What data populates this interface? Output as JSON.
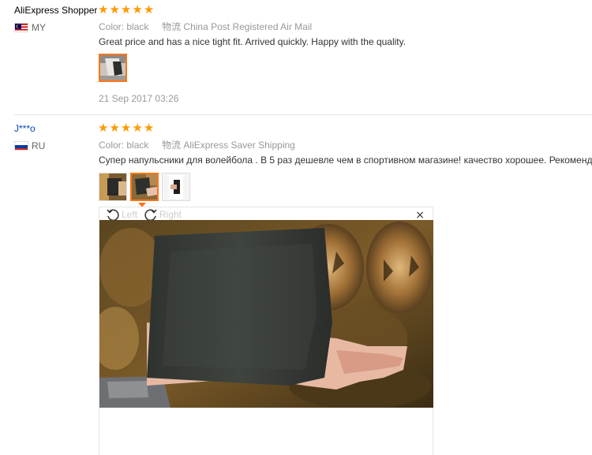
{
  "reviews": [
    {
      "user": "AliExpress Shopper",
      "country": "MY",
      "rating": 5,
      "color_label": "Color:",
      "color_value": "black",
      "shipping_label": "物流",
      "shipping_value": "China Post Registered Air Mail",
      "text": "Great price and has a nice tight fit. Arrived quickly. Happy with the quality.",
      "date": "21 Sep 2017 03:26"
    },
    {
      "user": "J***o",
      "country": "RU",
      "rating": 5,
      "color_label": "Color:",
      "color_value": "black",
      "shipping_label": "物流",
      "shipping_value": "AliExpress Saver Shipping",
      "text": "Супер напульсники для волейбола . В 5 раз дешевле чем в спортивном магазине! качество хорошее. Рекомендую."
    }
  ],
  "viewer": {
    "rotate_left_label": "Left",
    "rotate_right_label": "Right",
    "close_glyph": "×"
  },
  "colors": {
    "star": "#ff9900",
    "active_thumb": "#ff7519",
    "username_link": "#0046c0"
  },
  "icons": {
    "rotate_left": "rotate-left-icon",
    "rotate_right": "rotate-right-icon",
    "close": "close-icon"
  }
}
